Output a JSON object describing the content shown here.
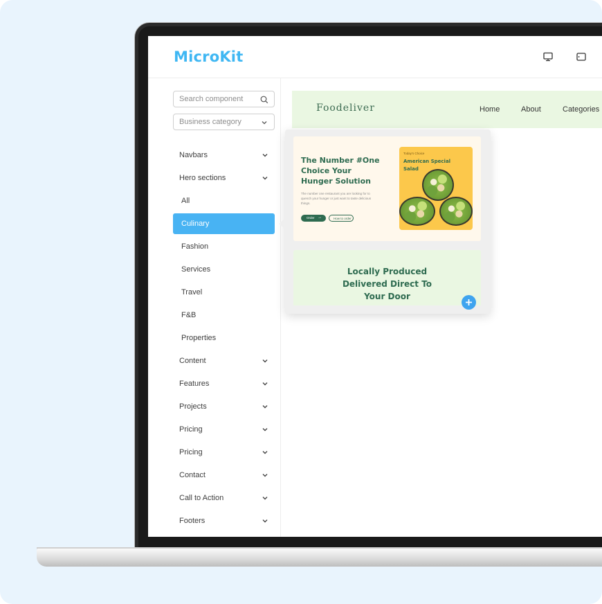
{
  "app": {
    "title": "MicroKit"
  },
  "toolbar": {
    "icons": [
      "desktop-icon",
      "tablet-icon"
    ]
  },
  "sidebar": {
    "search_placeholder": "Search component",
    "category_placeholder": "Business category",
    "items": [
      {
        "label": "Navbars",
        "expandable": true
      },
      {
        "label": "Hero sections",
        "expandable": true
      },
      {
        "label": "All",
        "sub": true
      },
      {
        "label": "Culinary",
        "sub": true,
        "active": true
      },
      {
        "label": "Fashion",
        "sub": true
      },
      {
        "label": "Services",
        "sub": true
      },
      {
        "label": "Travel",
        "sub": true
      },
      {
        "label": "F&B",
        "sub": true
      },
      {
        "label": "Properties",
        "sub": true
      },
      {
        "label": "Content",
        "expandable": true
      },
      {
        "label": "Features",
        "expandable": true
      },
      {
        "label": "Projects",
        "expandable": true
      },
      {
        "label": "Pricing",
        "expandable": true
      },
      {
        "label": "Pricing",
        "expandable": true
      },
      {
        "label": "Contact",
        "expandable": true
      },
      {
        "label": "Call to Action",
        "expandable": true
      },
      {
        "label": "Footers",
        "expandable": true
      }
    ]
  },
  "preview": {
    "brand": "Foodeliver",
    "links": [
      "Home",
      "About",
      "Categories"
    ]
  },
  "popup": {
    "card1": {
      "title": "The Number #One Choice Your Hunger Solution",
      "description": "The number one restaurant you are looking for to quench your hunger or just want to taste delicious things.",
      "btn_primary": "Order",
      "btn_secondary": "How to order",
      "food_kicker": "Today's Choice",
      "food_title": "American Special Salad"
    },
    "card2": {
      "title_line1": "Locally Produced",
      "title_line2": "Delivered Direct To",
      "title_line3": "Your Door"
    }
  },
  "colors": {
    "accent": "#48b3f3",
    "brand_green": "#2e6b50",
    "mint": "#eaf7e2",
    "yellow": "#fcc84b"
  }
}
